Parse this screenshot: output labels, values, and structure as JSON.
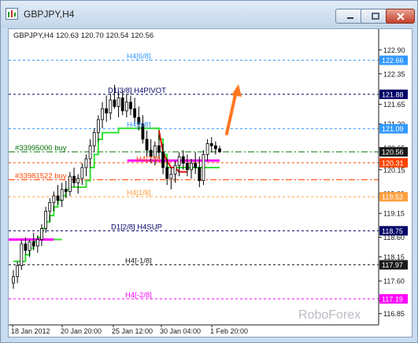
{
  "window": {
    "title": "GBPJPY,H4"
  },
  "chart_header": {
    "symbol": "GBPJPY,H4",
    "ohlc": "120.63 120.70 120.54 120.56"
  },
  "watermark": "RoboForex",
  "colors": {
    "background": "#ffffff",
    "text": "#1a1a1a",
    "green_line": "#33e033",
    "red_line": "#e01010",
    "magenta_line": "#ff00ff",
    "orange_level": "#f07020",
    "orange_label_bg": "#ff4400",
    "light_orange_label_bg": "#ffa040",
    "blue_label_bg": "#3399ff",
    "navy_label_bg": "#000066",
    "magenta_label_bg": "#ff00ff",
    "dark_label_bg": "#1a1a1a",
    "green_level": "#007000",
    "arrow": "#ff7722"
  },
  "chart_data": {
    "type": "candlestick",
    "y_ticks": [
      "122.90",
      "122.35",
      "121.65",
      "121.20",
      "120.65",
      "120.15",
      "119.60",
      "119.15",
      "118.60",
      "118.15",
      "117.60",
      "117.15",
      "116.85"
    ],
    "x_ticks": [
      "18 Jan 2012",
      "20 Jan 20:00",
      "25 Jan 12:00",
      "30 Jan 04:00",
      "1 Feb 20:00"
    ],
    "ylim": [
      116.7,
      123.05
    ],
    "price_labels": [
      {
        "value": "122.66",
        "price": 122.66,
        "color": "blue"
      },
      {
        "value": "121.88",
        "price": 121.88,
        "color": "navy"
      },
      {
        "value": "121.09",
        "price": 121.09,
        "color": "blue"
      },
      {
        "value": "120.56",
        "price": 120.56,
        "color": "dark"
      },
      {
        "value": "120.31",
        "price": 120.31,
        "color": "orange"
      },
      {
        "value": "119.53",
        "price": 119.53,
        "color": "light_orange"
      },
      {
        "value": "118.75",
        "price": 118.75,
        "color": "navy"
      },
      {
        "value": "117.97",
        "price": 117.97,
        "color": "dark"
      },
      {
        "value": "117.19",
        "price": 117.19,
        "color": "magenta"
      }
    ],
    "levels": [
      {
        "label": "H4[6/8]",
        "price": 122.66,
        "color": "blue"
      },
      {
        "label": "D1[3/8] H4PIVOT",
        "price": 121.88,
        "color": "navy"
      },
      {
        "label": "H4[5/8]",
        "price": 121.09,
        "color": "blue"
      },
      {
        "label": "#33995000 buy",
        "price": 120.56,
        "color": "green"
      },
      {
        "label": "H4[2/8]",
        "price": 120.31,
        "color": "orange"
      },
      {
        "label": "#33981522 buy",
        "price": 119.92,
        "color": "orange"
      },
      {
        "label": "H4[1/8]",
        "price": 119.53,
        "color": "light_orange"
      },
      {
        "label": "D1[2/8] H4SUP",
        "price": 118.75,
        "color": "navy"
      },
      {
        "label": "H4[-1/8]",
        "price": 117.97,
        "color": "dark"
      },
      {
        "label": "H4[-2/8]",
        "price": 117.19,
        "color": "magenta"
      }
    ],
    "candles": [
      [
        117.55,
        117.85,
        117.42,
        117.7
      ],
      [
        117.7,
        118.05,
        117.55,
        117.95
      ],
      [
        117.95,
        118.55,
        117.85,
        118.45
      ],
      [
        118.45,
        118.6,
        118.2,
        118.3
      ],
      [
        118.3,
        118.55,
        118.15,
        118.5
      ],
      [
        118.5,
        118.7,
        118.3,
        118.4
      ],
      [
        118.4,
        118.65,
        118.25,
        118.55
      ],
      [
        118.55,
        118.9,
        118.4,
        118.8
      ],
      [
        118.8,
        119.3,
        118.7,
        119.2
      ],
      [
        119.2,
        119.5,
        118.95,
        119.4
      ],
      [
        119.4,
        119.65,
        119.2,
        119.55
      ],
      [
        119.55,
        119.8,
        119.35,
        119.45
      ],
      [
        119.45,
        119.85,
        119.3,
        119.7
      ],
      [
        119.7,
        119.9,
        119.5,
        119.65
      ],
      [
        119.65,
        120.1,
        119.55,
        120.0
      ],
      [
        120.0,
        120.2,
        119.75,
        119.85
      ],
      [
        119.85,
        120.05,
        119.6,
        119.95
      ],
      [
        119.95,
        120.3,
        119.8,
        120.2
      ],
      [
        120.2,
        120.5,
        120.0,
        120.4
      ],
      [
        120.4,
        120.85,
        120.2,
        120.7
      ],
      [
        120.7,
        121.1,
        120.55,
        121.0
      ],
      [
        121.0,
        121.4,
        120.8,
        121.3
      ],
      [
        121.3,
        121.7,
        121.1,
        121.55
      ],
      [
        121.55,
        121.85,
        121.25,
        121.45
      ],
      [
        121.45,
        121.9,
        121.3,
        121.75
      ],
      [
        121.75,
        122.1,
        121.55,
        121.6
      ],
      [
        121.6,
        121.95,
        121.35,
        121.8
      ],
      [
        121.8,
        121.95,
        121.4,
        121.5
      ],
      [
        121.5,
        121.9,
        121.35,
        121.7
      ],
      [
        121.7,
        121.85,
        121.4,
        121.55
      ],
      [
        121.55,
        121.8,
        121.2,
        121.35
      ],
      [
        121.35,
        121.6,
        121.05,
        121.2
      ],
      [
        121.2,
        121.4,
        120.75,
        120.85
      ],
      [
        120.85,
        121.05,
        120.45,
        120.6
      ],
      [
        120.6,
        120.85,
        120.3,
        120.45
      ],
      [
        120.45,
        120.8,
        120.25,
        120.7
      ],
      [
        120.7,
        120.95,
        120.4,
        120.55
      ],
      [
        120.55,
        120.75,
        120.05,
        120.2
      ],
      [
        120.2,
        120.4,
        119.8,
        119.95
      ],
      [
        119.95,
        120.2,
        119.7,
        120.05
      ],
      [
        120.05,
        120.35,
        119.85,
        120.25
      ],
      [
        120.25,
        120.55,
        120.0,
        120.45
      ],
      [
        120.45,
        120.6,
        120.15,
        120.3
      ],
      [
        120.3,
        120.5,
        120.0,
        120.15
      ],
      [
        120.15,
        120.4,
        119.95,
        120.3
      ],
      [
        120.3,
        120.55,
        120.05,
        120.2
      ],
      [
        120.2,
        120.45,
        119.75,
        119.9
      ],
      [
        119.9,
        120.6,
        119.8,
        120.5
      ],
      [
        120.5,
        120.85,
        120.35,
        120.75
      ],
      [
        120.75,
        120.9,
        120.55,
        120.7
      ],
      [
        120.7,
        120.8,
        120.5,
        120.63
      ],
      [
        120.63,
        120.7,
        120.54,
        120.56
      ]
    ],
    "green_line": [
      118.05,
      118.05,
      118.05,
      118.2,
      118.35,
      118.5,
      118.6,
      118.8,
      118.95,
      119.1,
      119.3,
      119.45,
      119.55,
      119.7,
      119.75,
      119.75,
      119.75,
      119.75,
      119.9,
      120.2,
      120.5,
      120.85,
      121.0,
      121.0,
      121.0,
      121.0,
      121.1,
      121.1,
      121.1,
      121.1,
      121.1,
      121.1,
      121.1,
      121.1,
      121.1,
      121.1,
      120.85,
      120.5,
      120.2,
      120.2,
      120.2,
      120.2,
      120.2,
      120.2,
      120.2,
      120.2,
      120.2,
      120.2,
      120.2,
      120.2,
      120.2,
      120.2
    ],
    "green_line_lower": {
      "from_index": 10,
      "to_index": 12,
      "price": 118.55
    },
    "magenta_line": {
      "segment1": {
        "from_index": -1,
        "to_index": 10,
        "price": 118.55
      },
      "segment2": {
        "from_index": 34,
        "to_index": 51,
        "price": 120.36
      }
    },
    "red_line": [
      121.05,
      120.55,
      120.35,
      120.2,
      120.2,
      120.1,
      120.1,
      120.1
    ]
  }
}
